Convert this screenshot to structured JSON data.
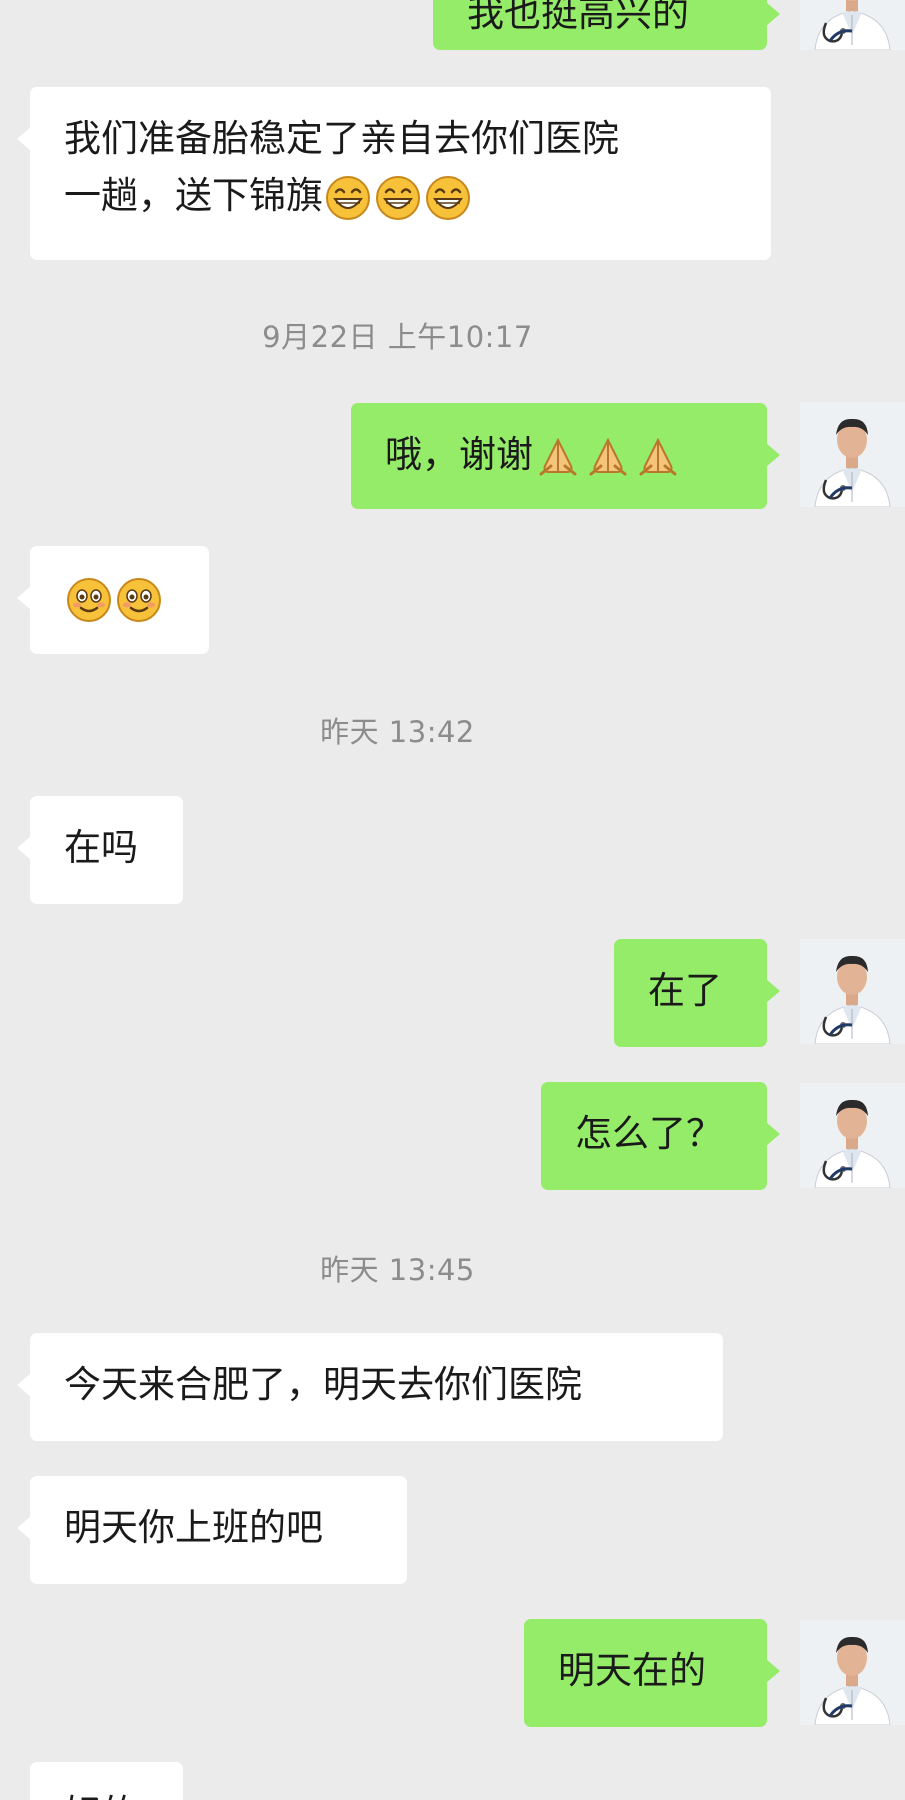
{
  "messages": {
    "top_out": "我也挺高兴的",
    "in_1_line1": "我们准备胎稳定了亲自去你们医院",
    "in_1_line2": "一趟，送下锦旗",
    "out_thanks": "哦，谢谢",
    "in_zaima": "在吗",
    "out_zaile": "在了",
    "out_zenmele": "怎么了？",
    "in_jintian": "今天来合肥了，明天去你们医院",
    "in_mingtian": "明天你上班的吧",
    "out_mingtianzaide": "明天在的",
    "in_bottom_partial": "好的"
  },
  "timestamps": {
    "t1": "9月22日 上午10:17",
    "t2": "昨天 13:42",
    "t3": "昨天 13:45"
  },
  "icons": {
    "grin": "grin-emoji",
    "pray": "pray-emoji",
    "smile": "smile-emoji",
    "avatar": "doctor-avatar"
  },
  "colors": {
    "background": "#ebebeb",
    "incoming_bubble": "#ffffff",
    "outgoing_bubble": "#95ec69",
    "timestamp_text": "#8c8c8c"
  }
}
